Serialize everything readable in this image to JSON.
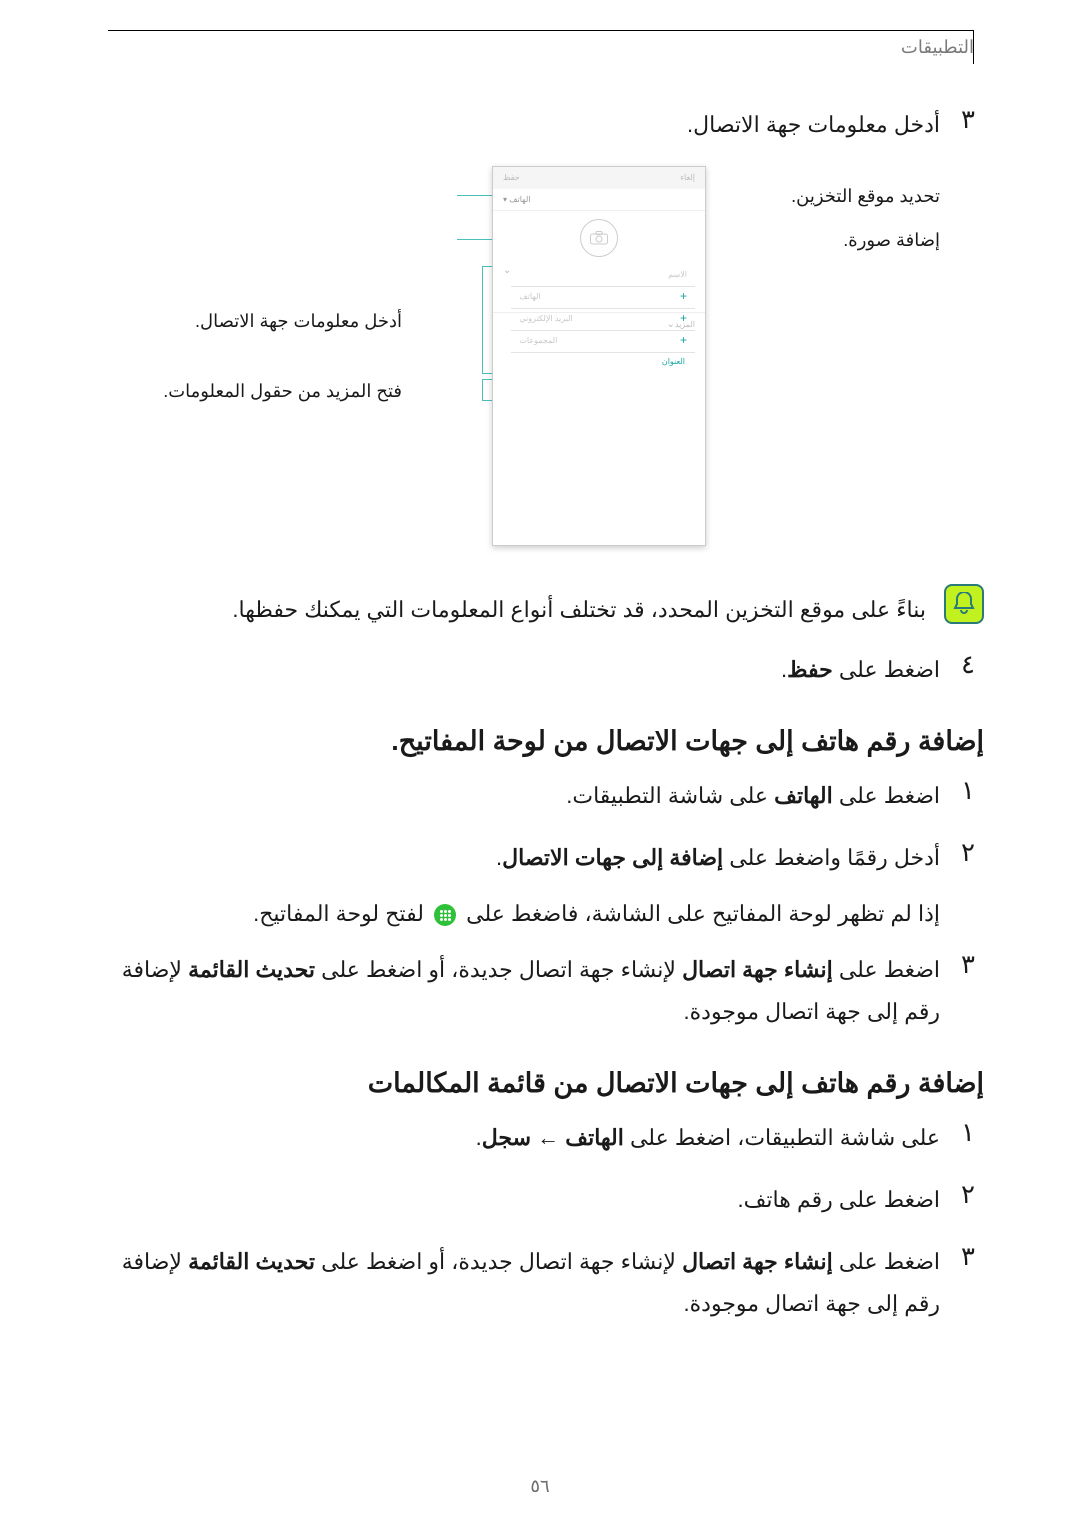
{
  "header": {
    "title": "التطبيقات"
  },
  "step3_top": {
    "num": "٣",
    "text": "أدخل معلومات جهة الاتصال."
  },
  "figure": {
    "storage_label": "تحديد موقع التخزين.",
    "photo_label": "إضافة صورة.",
    "fields_label": "أدخل معلومات جهة الاتصال.",
    "more_label": "فتح المزيد من حقول المعلومات.",
    "phone": {
      "topbar_left": "إلغاء",
      "topbar_right": "حفظ",
      "storage_row": "الهاتف ▾",
      "name": "الاسم",
      "phone": "الهاتف",
      "email": "البريد الإلكتروني",
      "groups": "المجموعات",
      "more": "المزيد",
      "address": "العنوان"
    }
  },
  "note": {
    "text": "بناءً على موقع التخزين المحدد، قد تختلف أنواع المعلومات التي يمكنك حفظها."
  },
  "step4": {
    "num": "٤",
    "pre": "اضغط على ",
    "bold": "حفظ",
    "post": "."
  },
  "section_keypad": {
    "title": "إضافة رقم هاتف إلى جهات الاتصال من لوحة المفاتيح."
  },
  "kp_step1": {
    "num": "١",
    "pre": "اضغط على ",
    "bold": "الهاتف",
    "post": " على شاشة التطبيقات."
  },
  "kp_step2": {
    "num": "٢",
    "pre": "أدخل رقمًا واضغط على ",
    "bold": "إضافة إلى جهات الاتصال",
    "post": "."
  },
  "kp_step2_sub": {
    "pre": "إذا لم تظهر لوحة المفاتيح على الشاشة، فاضغط على ",
    "post": " لفتح لوحة المفاتيح."
  },
  "kp_step3": {
    "num": "٣",
    "pre": "اضغط على ",
    "bold1": "إنشاء جهة اتصال",
    "mid": " لإنشاء جهة اتصال جديدة، أو اضغط على ",
    "bold2": "تحديث القائمة",
    "post": " لإضافة رقم إلى جهة اتصال موجودة."
  },
  "section_calls": {
    "title": "إضافة رقم هاتف إلى جهات الاتصال من قائمة المكالمات"
  },
  "cl_step1": {
    "num": "١",
    "pre": "على شاشة التطبيقات، اضغط على ",
    "bold1": "الهاتف",
    "arrow": " ← ",
    "bold2": "سجل",
    "post": "."
  },
  "cl_step2": {
    "num": "٢",
    "text": "اضغط على رقم هاتف."
  },
  "cl_step3": {
    "num": "٣",
    "pre": "اضغط على ",
    "bold1": "إنشاء جهة اتصال",
    "mid": " لإنشاء جهة اتصال جديدة، أو اضغط على ",
    "bold2": "تحديث القائمة",
    "post": " لإضافة رقم إلى جهة اتصال موجودة."
  },
  "page_number": "٥٦"
}
